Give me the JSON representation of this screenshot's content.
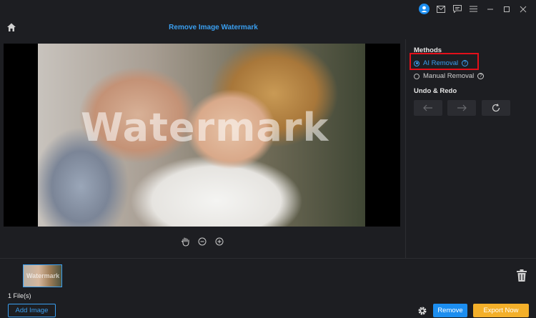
{
  "header": {
    "title": "Remove Image Watermark"
  },
  "titlebar": {
    "icons": [
      "user-icon",
      "mail-icon",
      "feedback-icon",
      "menu-icon",
      "minimize-icon",
      "maximize-icon",
      "close-icon"
    ]
  },
  "canvas": {
    "watermark_text": "Watermark"
  },
  "zoom": {
    "icons": [
      "hand-icon",
      "zoom-out-icon",
      "zoom-in-icon"
    ]
  },
  "panel": {
    "methods_heading": "Methods",
    "ai_label": "AI Removal",
    "manual_label": "Manual Removal",
    "undo_heading": "Undo & Redo",
    "selected_method": "AI Removal"
  },
  "bottom": {
    "thumb_wm": "Watermark",
    "files_count": "1 File(s)",
    "add_label": "Add Image",
    "remove_label": "Remove",
    "export_label": "Export Now"
  },
  "colors": {
    "accent": "#3a9ff0",
    "export": "#f4b02a",
    "highlight": "#e3101a",
    "background": "#1d1e22"
  }
}
